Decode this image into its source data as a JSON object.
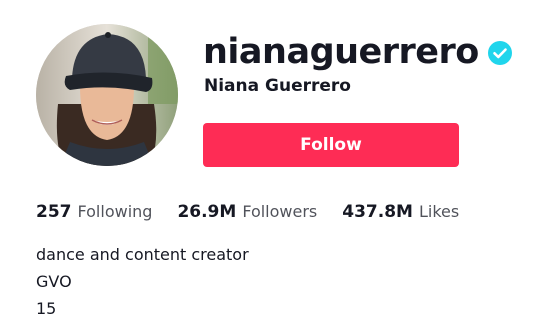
{
  "profile": {
    "username": "nianaguerrero",
    "display_name": "Niana Guerrero",
    "verified_icon": "verified-check-icon",
    "avatar": "profile-photo"
  },
  "actions": {
    "follow_label": "Follow"
  },
  "stats": [
    {
      "number": "257",
      "label": "Following"
    },
    {
      "number": "26.9M",
      "label": "Followers"
    },
    {
      "number": "437.8M",
      "label": "Likes"
    }
  ],
  "bio": [
    "dance and content creator",
    "GVO",
    "15"
  ],
  "colors": {
    "accent": "#fe2c55",
    "verified": "#20d5ec",
    "text": "#161823"
  }
}
